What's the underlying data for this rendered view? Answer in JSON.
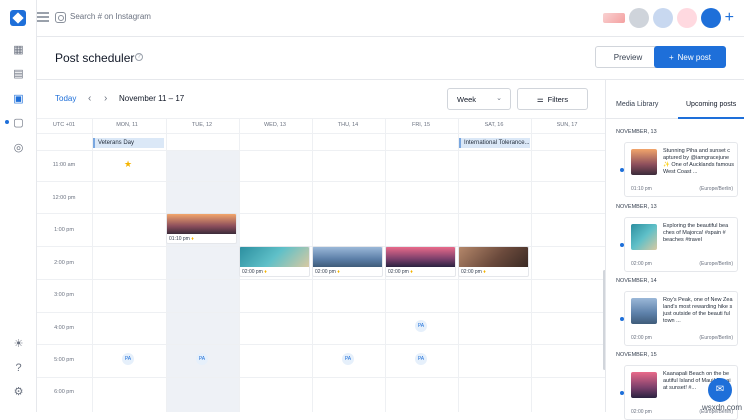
{
  "app": {
    "search_placeholder": "Search # on Instagram"
  },
  "header": {
    "title": "Post scheduler",
    "preview_label": "Preview",
    "new_post_label": "New post"
  },
  "toolbar": {
    "today_label": "Today",
    "range_label": "November 11 – 17",
    "view_select": "Week",
    "filters_label": "Filters"
  },
  "calendar": {
    "timezone_label": "UTC +01",
    "days": [
      "MON, 11",
      "TUE, 12",
      "WED, 13",
      "THU, 14",
      "FRI, 15",
      "SAT, 16",
      "SUN, 17"
    ],
    "times": [
      "11:00 am",
      "12:00 pm",
      "1:00 pm",
      "2:00 pm",
      "3:00 pm",
      "4:00 pm",
      "5:00 pm",
      "6:00 pm"
    ],
    "holidays": [
      "Veterans Day",
      "International Tolerance..."
    ],
    "posts": [
      {
        "time": "01:10 pm"
      },
      {
        "time": "02:00 pm"
      },
      {
        "time": "02:00 pm"
      },
      {
        "time": "02:00 pm"
      },
      {
        "time": "02:00 pm"
      }
    ],
    "pa_badge": "PA"
  },
  "right_panel": {
    "tabs": [
      "Media Library",
      "Upcoming posts"
    ],
    "groups": [
      {
        "day": "NOVEMBER, 13",
        "caption": "Stunning Piha and sunset c aptured by @iamgracejune ✨ One of Aucklands famous West Coast ...",
        "time": "01:10 pm",
        "tz": "(Europe/Berlin)"
      },
      {
        "day": "NOVEMBER, 13",
        "caption": "Exploring the beautiful bea ches of Majorca! #spain # beaches #travel",
        "time": "02:00 pm",
        "tz": "(Europe/Berlin)"
      },
      {
        "day": "NOVEMBER, 14",
        "caption": "Roy's Peak, one of New Zea land's most rewarding hike s just outside of the beauti ful town ...",
        "time": "02:00 pm",
        "tz": "(Europe/Berlin)"
      },
      {
        "day": "NOVEMBER, 15",
        "caption": "Kaanapali Beach on the be autiful Island of Maui! Fre ai at sunset! #...",
        "time": "02:00 pm",
        "tz": "(Europe/Berlin)"
      }
    ]
  },
  "watermark": "wsxdn.com",
  "colors": {
    "accent": "#1e6fd9",
    "holiday_bg": "#dbe8f7",
    "star": "#f5b400"
  }
}
